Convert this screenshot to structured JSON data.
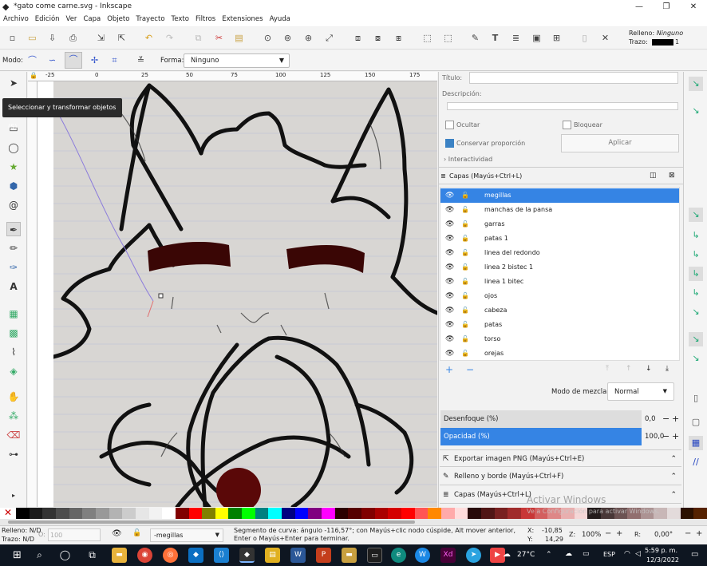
{
  "window": {
    "title": "*gato come carne.svg - Inkscape"
  },
  "menu": [
    "Archivo",
    "Edición",
    "Ver",
    "Capa",
    "Objeto",
    "Trayecto",
    "Texto",
    "Filtros",
    "Extensiones",
    "Ayuda"
  ],
  "fill_stroke": {
    "fill_label": "Relleno:",
    "fill_value": "Ninguno",
    "stroke_label": "Trazo:",
    "stroke_width": "1"
  },
  "tool_controls": {
    "mode_label": "Modo:",
    "shape_label": "Forma:",
    "shape_value": "Ninguno"
  },
  "ruler_ticks": [
    "-25",
    "0",
    "25",
    "50",
    "75",
    "100",
    "125",
    "150",
    "175"
  ],
  "tooltip": "Seleccionar y transformar objetos (S)",
  "object_props": {
    "title_label": "Título:",
    "description_label": "Descripción:",
    "hide_label": "Ocultar",
    "lock_label": "Bloquear",
    "preserve_label": "Conservar proporción",
    "apply_label": "Aplicar",
    "interactivity_label": "Interactividad"
  },
  "layers_panel": {
    "title": "Capas (Mayús+Ctrl+L)",
    "layers": [
      {
        "name": "megillas",
        "selected": true
      },
      {
        "name": "manchas de la pansa"
      },
      {
        "name": "garras"
      },
      {
        "name": "patas 1"
      },
      {
        "name": "linea del redondo"
      },
      {
        "name": "linea 2 bistec 1"
      },
      {
        "name": "linea 1 bitec"
      },
      {
        "name": "ojos"
      },
      {
        "name": "cabeza"
      },
      {
        "name": "patas"
      },
      {
        "name": "torso"
      },
      {
        "name": "orejas"
      }
    ],
    "blend_label": "Modo de mezcla:",
    "blend_value": "Normal",
    "blur_label": "Desenfoque (%)",
    "blur_value": "0,0",
    "opacity_label": "Opacidad (%)",
    "opacity_value": "100,0"
  },
  "collapsed_panels": [
    "Exportar imagen PNG (Mayús+Ctrl+E)",
    "Relleno y borde (Mayús+Ctrl+F)",
    "Capas (Mayús+Ctrl+L)"
  ],
  "watermark": {
    "line1": "Activar Windows",
    "line2": "Ve a Configuración para activar Windows."
  },
  "status": {
    "fill_label": "Relleno:",
    "fill_value": "N/D",
    "stroke_label": "Trazo:",
    "stroke_value": "N/D",
    "opacity_prefix": "O:",
    "opacity_value": "100",
    "layer_value": "-megillas",
    "message": "Segmento de curva: ángulo -116,57°; con Mayús+clic nodo cúspide, Alt mover anterior, Enter o Mayús+Enter para terminar.",
    "x_label": "X:",
    "x_value": "-10,85",
    "y_label": "Y:",
    "y_value": "14,29",
    "zoom_label": "Z:",
    "zoom_value": "100%",
    "rot_label": "R:",
    "rot_value": "0,00°"
  },
  "taskbar": {
    "weather": "27°C",
    "lang": "ESP",
    "time": "5:59 p. m.",
    "date": "12/3/2022"
  },
  "colors": {
    "accent": "#3584e4",
    "taskbar": "#0e1621"
  }
}
